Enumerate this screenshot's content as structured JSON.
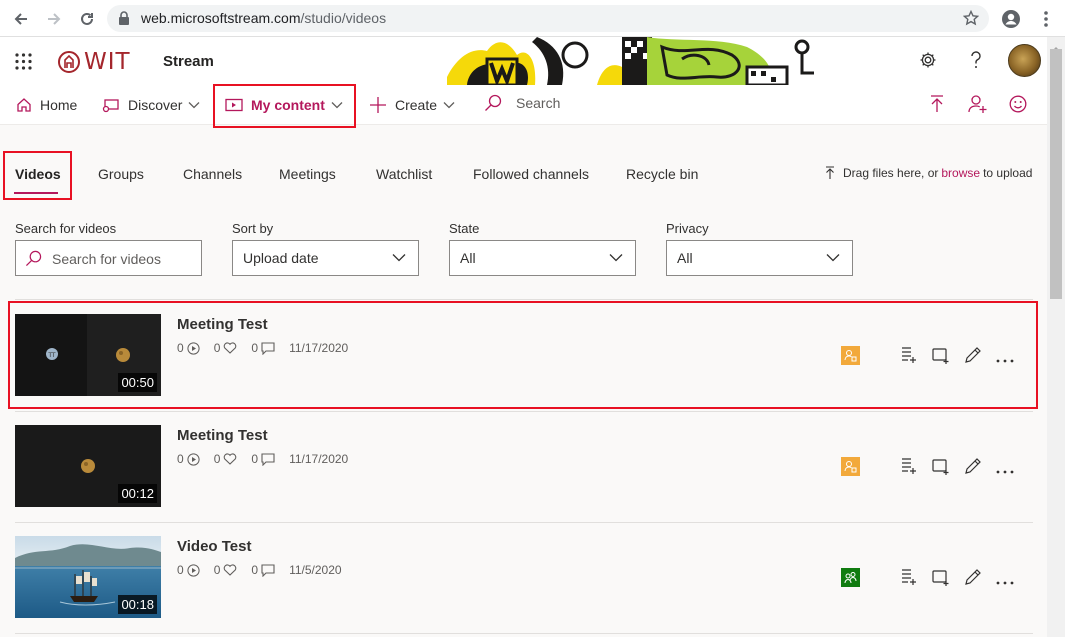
{
  "browser": {
    "url_host": "web.microsoftstream.com",
    "url_path": "/studio/videos"
  },
  "header": {
    "logo_text": "WIT",
    "app_name": "Stream"
  },
  "nav": {
    "home": "Home",
    "discover": "Discover",
    "my_content": "My content",
    "create": "Create",
    "search": "Search"
  },
  "tabs": [
    "Videos",
    "Groups",
    "Channels",
    "Meetings",
    "Watchlist",
    "Followed channels",
    "Recycle bin"
  ],
  "upload": {
    "prefix": "Drag files here, or",
    "link": "browse",
    "suffix": "to upload"
  },
  "filters": {
    "search_label": "Search for videos",
    "search_placeholder": "Search for videos",
    "sort_label": "Sort by",
    "sort_value": "Upload date",
    "state_label": "State",
    "state_value": "All",
    "privacy_label": "Privacy",
    "privacy_value": "All"
  },
  "videos": [
    {
      "title": "Meeting Test",
      "views": "0",
      "likes": "0",
      "comments": "0",
      "date": "11/17/2020",
      "duration": "00:50",
      "privacy_color": "#f2a93b"
    },
    {
      "title": "Meeting Test",
      "views": "0",
      "likes": "0",
      "comments": "0",
      "date": "11/17/2020",
      "duration": "00:12",
      "privacy_color": "#f2a93b"
    },
    {
      "title": "Video Test",
      "views": "0",
      "likes": "0",
      "comments": "0",
      "date": "11/5/2020",
      "duration": "00:18",
      "privacy_color": "#107c10"
    }
  ],
  "colors": {
    "accent": "#b4185c",
    "highlight_box": "#e81123"
  }
}
